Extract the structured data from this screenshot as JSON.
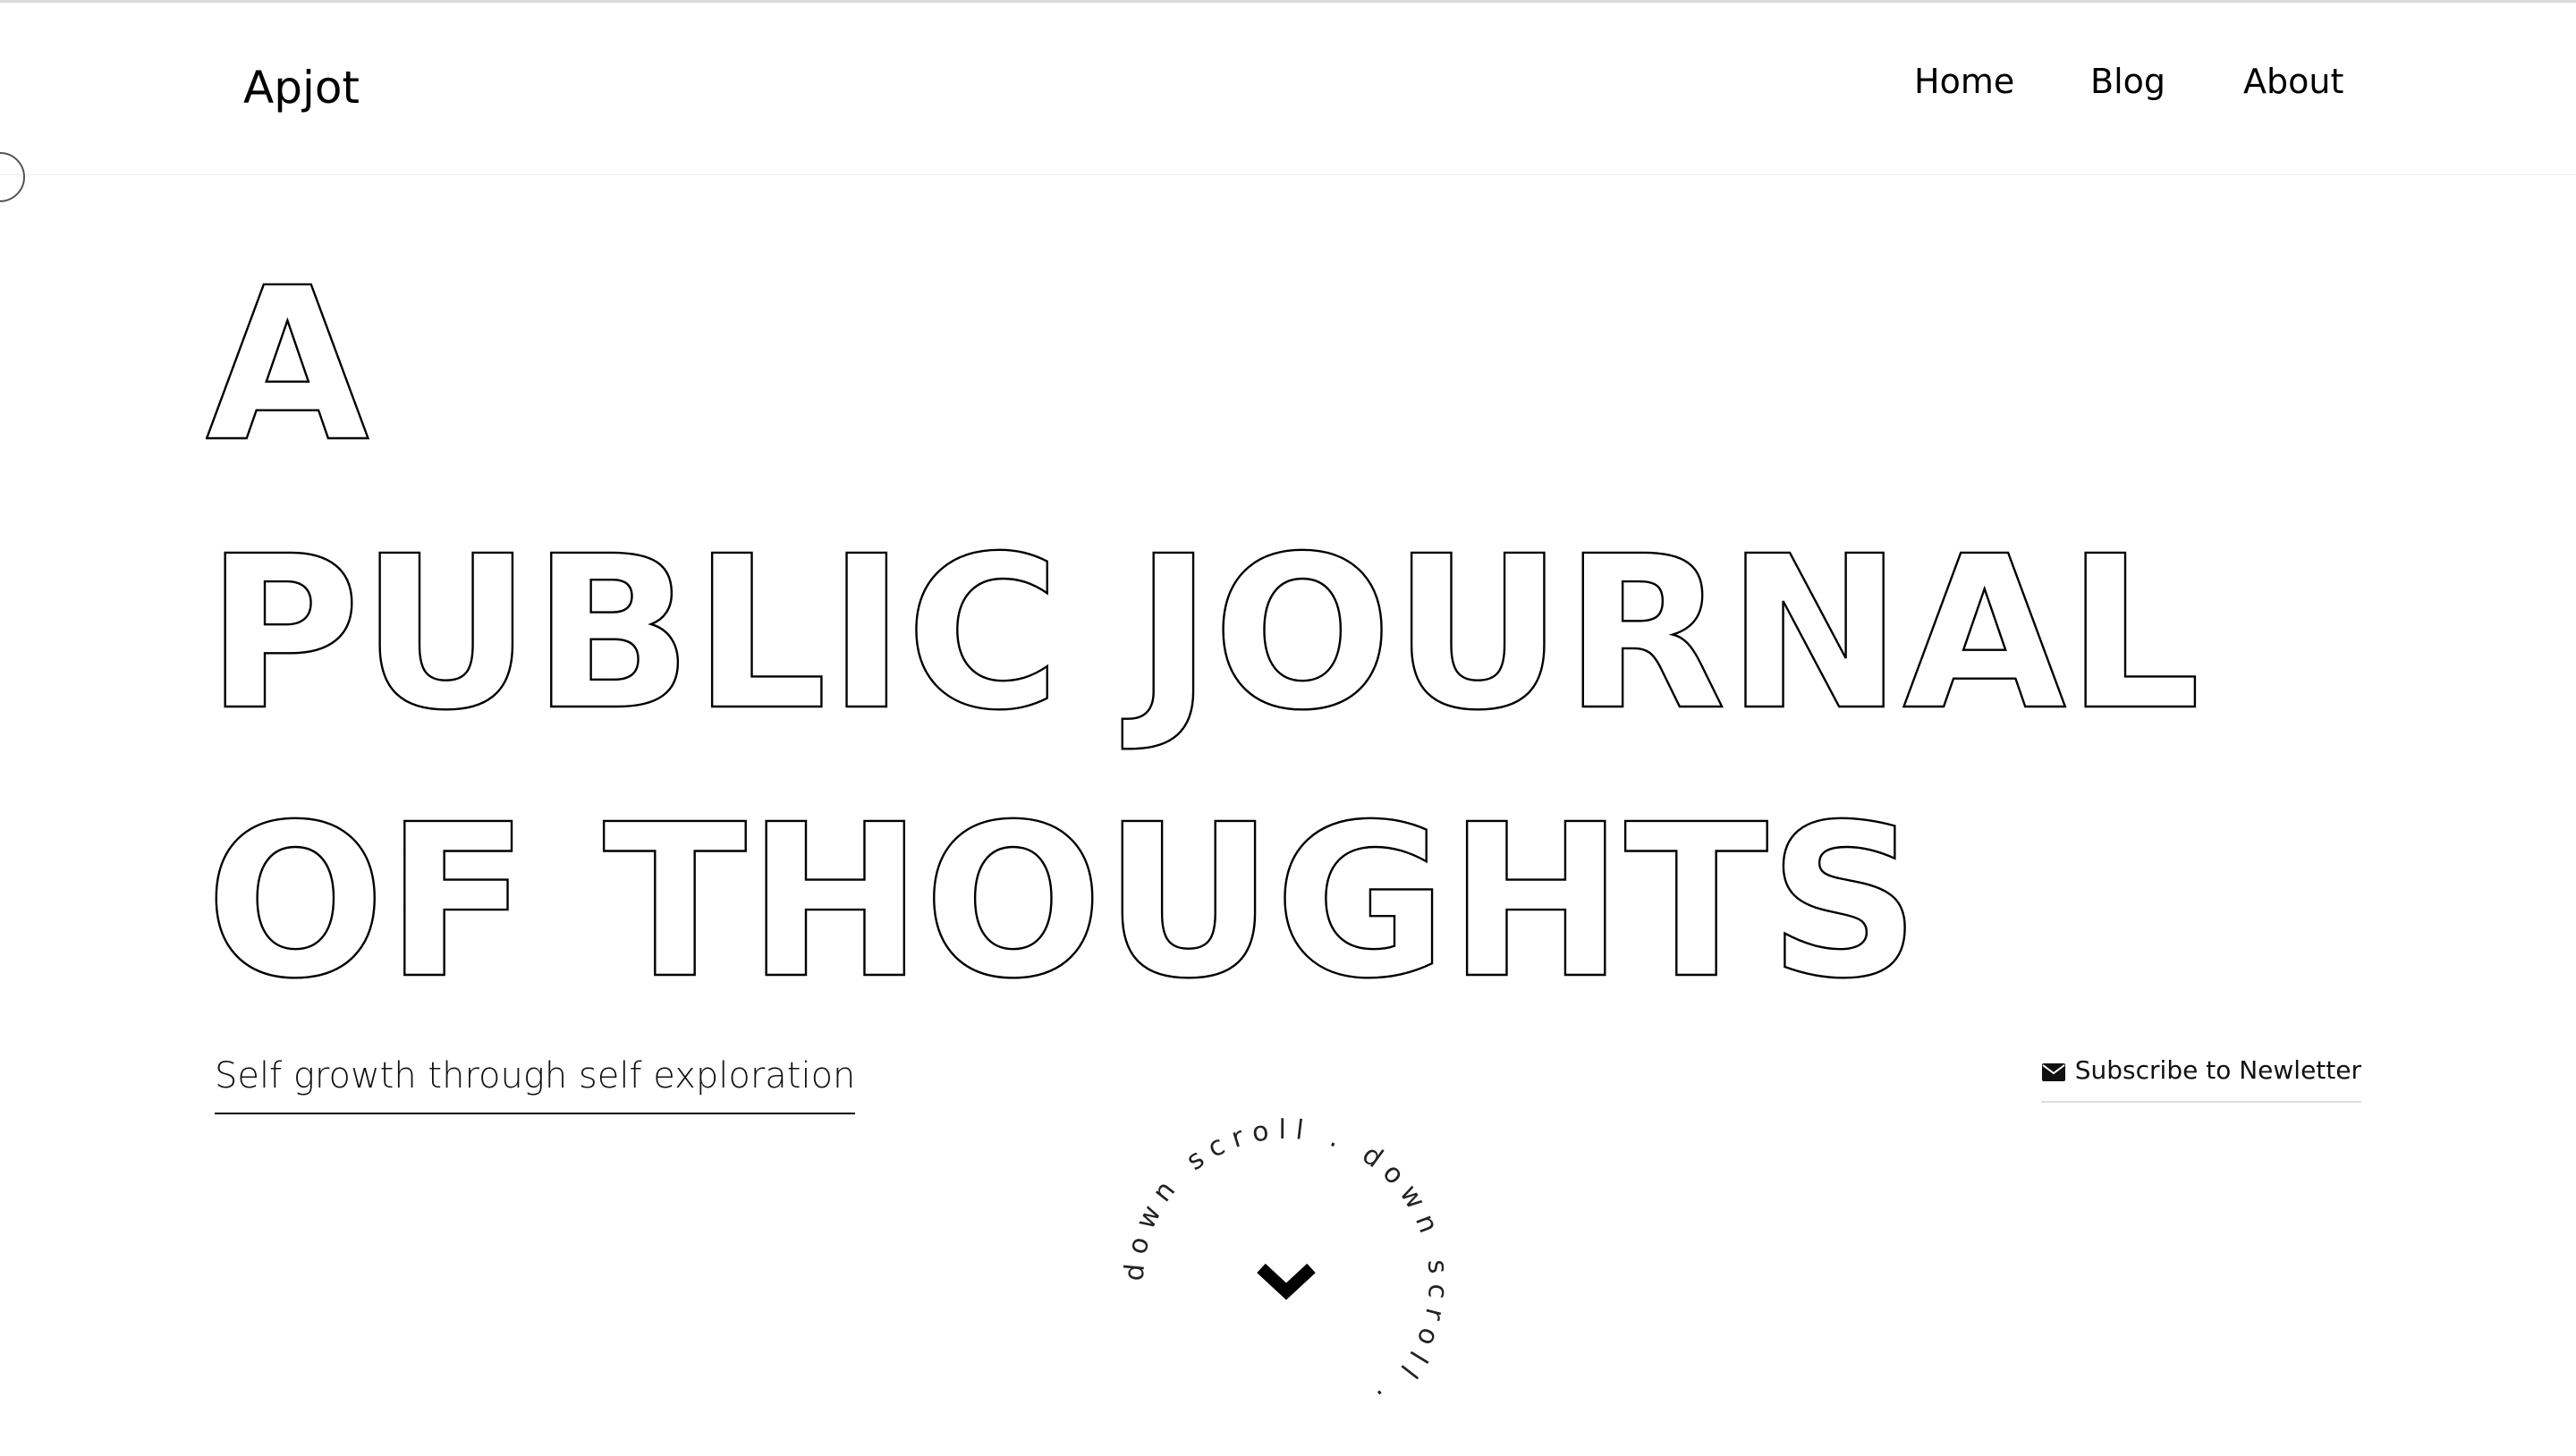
{
  "header": {
    "logo": "Apjot",
    "nav": [
      {
        "label": "Home"
      },
      {
        "label": "Blog"
      },
      {
        "label": "About"
      }
    ]
  },
  "hero": {
    "headline_lines": [
      "A",
      "PUBLIC JOURNAL",
      "OF THOUGHTS"
    ],
    "tagline": "Self growth through self exploration",
    "subscribe_label": "Subscribe to Newletter",
    "subscribe_icon": "envelope-icon",
    "scroll_ring_text": "down scroll . down scroll .",
    "scroll_icon": "chevron-down-icon"
  },
  "colors": {
    "background": "#ffffff",
    "text": "#000000",
    "rule": "#d9d9d9"
  }
}
